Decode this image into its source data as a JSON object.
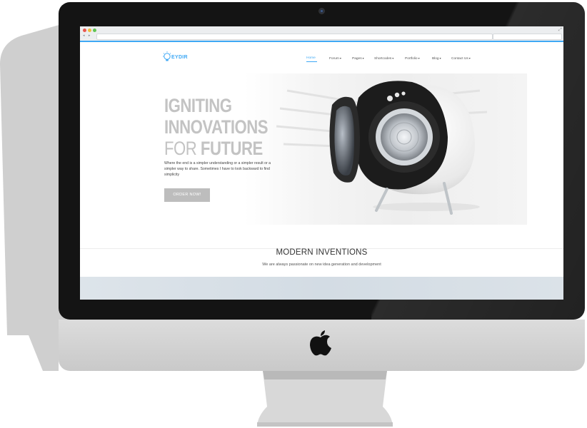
{
  "browser": {
    "url": "",
    "search_placeholder": "",
    "nav_arrows": "◂ ▸"
  },
  "site": {
    "logo_text": "EYDIR",
    "accent_color": "#3fa9f5",
    "nav": [
      {
        "label": "Home",
        "active": true
      },
      {
        "label": "Forum",
        "active": false
      },
      {
        "label": "Pages",
        "active": false
      },
      {
        "label": "Shortcodes",
        "active": false
      },
      {
        "label": "Portfolio",
        "active": false
      },
      {
        "label": "Blog",
        "active": false
      },
      {
        "label": "Contact Us",
        "active": false
      }
    ]
  },
  "hero": {
    "title_line1": "IGNITING",
    "title_line2": "INNOVATIONS",
    "title_line3_light": "FOR ",
    "title_line3_bold": "FUTURE",
    "description": "Where the end is a simpler understanding or a simpler result or a simpler way to share. Sometimes I have to look backward to find simplicity",
    "button_label": "ORDER NOW!"
  },
  "section": {
    "title": "MODERN INVENTIONS",
    "subtitle": "We are always passionate on new idea generation and development"
  },
  "icons": [
    "apple-logo-icon",
    "webcam-icon",
    "lightbulb-logo-icon",
    "caret-down-icon",
    "expand-icon"
  ]
}
